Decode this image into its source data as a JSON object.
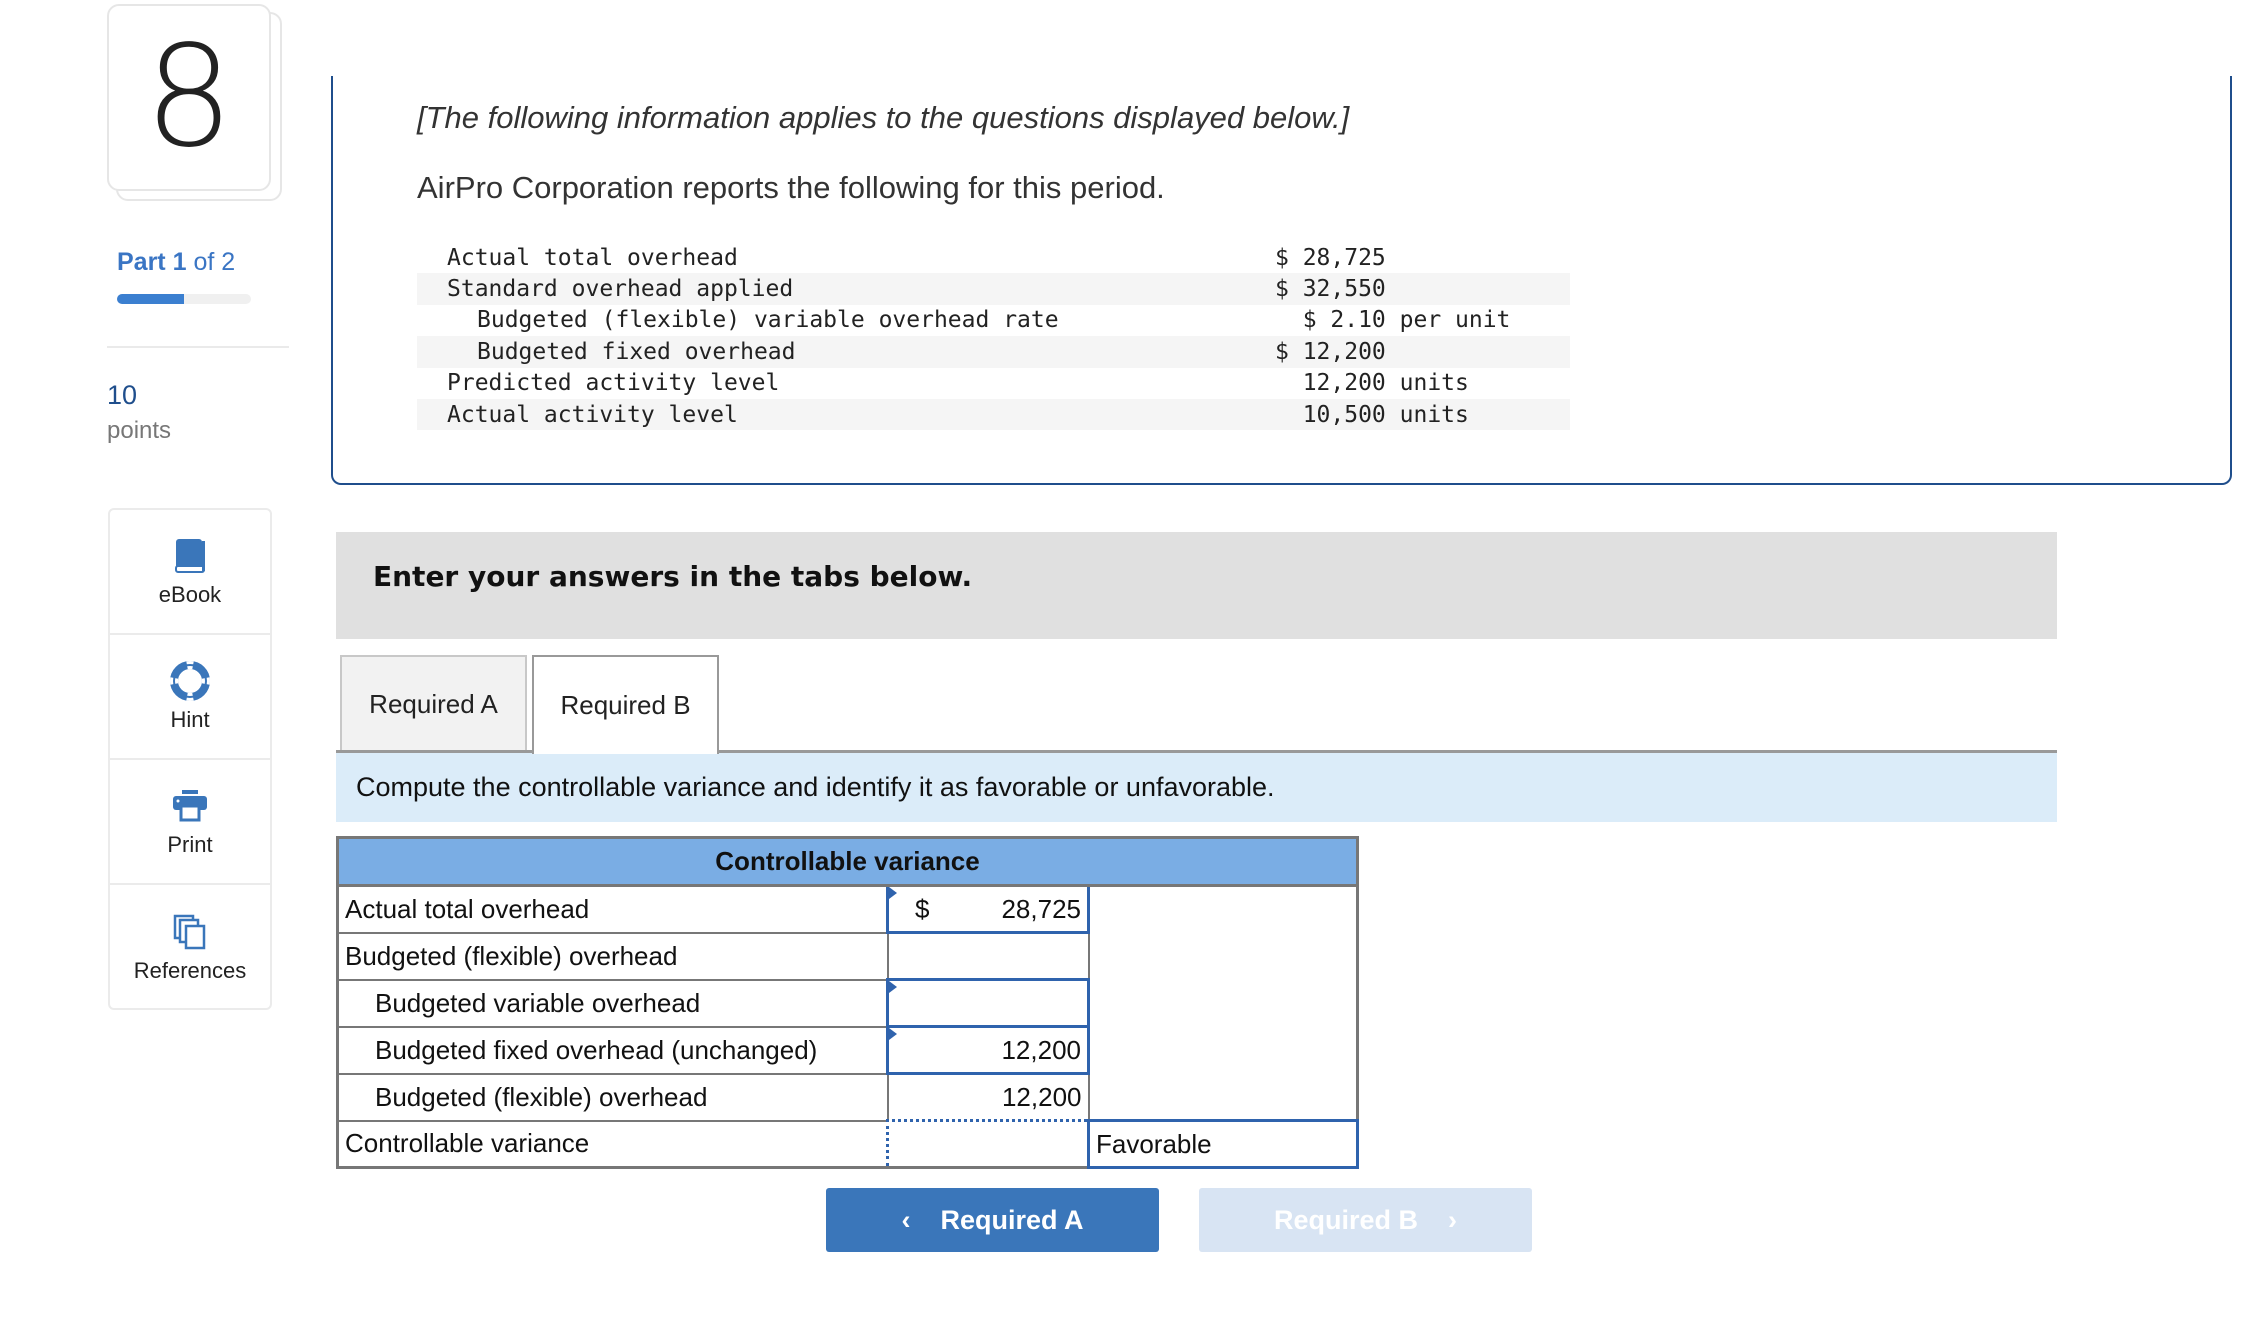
{
  "question": {
    "number": "8",
    "part_label": "Part",
    "part_current": "1",
    "part_of": "of 2",
    "progress_percent": 50,
    "points_value": "10",
    "points_label": "points"
  },
  "tools": [
    {
      "label": "eBook",
      "icon": "book-icon"
    },
    {
      "label": "Hint",
      "icon": "lifebuoy-icon"
    },
    {
      "label": "Print",
      "icon": "printer-icon"
    },
    {
      "label": "References",
      "icon": "copy-icon"
    }
  ],
  "info": {
    "intro": "[The following information applies to the questions displayed below.]",
    "company": "AirPro Corporation reports the following for this period.",
    "rows": [
      {
        "label": "Actual total overhead",
        "value": "$ 28,725"
      },
      {
        "label": "Standard overhead applied",
        "value": "$ 32,550"
      },
      {
        "label": "Budgeted (flexible) variable overhead rate",
        "value": "  $ 2.10 per unit"
      },
      {
        "label": "Budgeted fixed overhead",
        "value": "$ 12,200"
      },
      {
        "label": "Predicted activity level",
        "value": "  12,200 units"
      },
      {
        "label": "Actual activity level",
        "value": "  10,500 units"
      }
    ]
  },
  "banner": "Enter your answers in the tabs below.",
  "tabs": [
    {
      "label": "Required A"
    },
    {
      "label": "Required B",
      "active": true
    }
  ],
  "instruction": "Compute the controllable variance and identify it as favorable or unfavorable.",
  "variance_table": {
    "title": "Controllable variance",
    "rows": [
      {
        "label": "Actual total overhead",
        "prefix": "$",
        "value": "28,725"
      },
      {
        "label": "Budgeted (flexible) overhead",
        "value": ""
      },
      {
        "label": "Budgeted variable overhead",
        "value": ""
      },
      {
        "label": "Budgeted fixed overhead (unchanged)",
        "value": "12,200"
      },
      {
        "label": "Budgeted (flexible) overhead",
        "value": "12,200"
      },
      {
        "label": "Controllable variance",
        "value": "",
        "type": "Favorable"
      }
    ]
  },
  "nav": {
    "prev": "Required A",
    "next": "Required B"
  },
  "colors": {
    "accent": "#3a76ba",
    "table_header": "#7aade4",
    "instruction_bg": "#dbecf9",
    "border": "#1f4e8c"
  }
}
